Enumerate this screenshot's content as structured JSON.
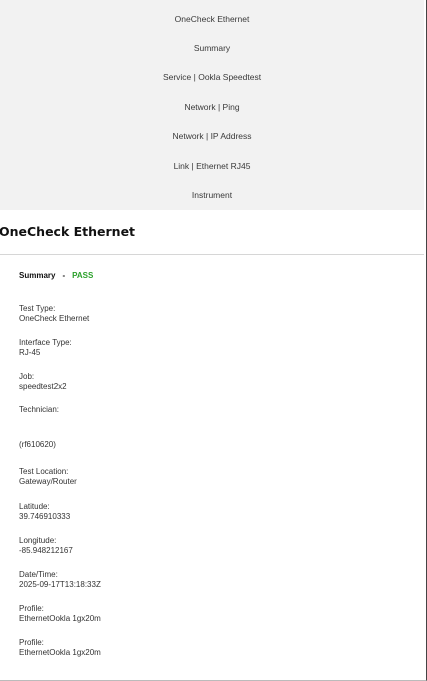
{
  "nav": {
    "items": [
      "OneCheck Ethernet",
      "Summary",
      "Service | Ookla Speedtest",
      "Network | Ping",
      "Network | IP Address",
      "Link | Ethernet RJ45",
      "Instrument"
    ]
  },
  "page": {
    "title": "OneCheck Ethernet"
  },
  "summary": {
    "label": "Summary",
    "separator": "-",
    "status": "PASS",
    "status_color": "#2aa02a"
  },
  "fields": [
    {
      "label": "Test Type:",
      "value": "OneCheck Ethernet"
    },
    {
      "label": "Interface Type:",
      "value": "RJ-45"
    },
    {
      "label": "Job:",
      "value": "speedtest2x2"
    },
    {
      "label": "Technician:",
      "value": ""
    },
    {
      "label": "",
      "value": "(rf610620)"
    },
    {
      "label": "Test Location:",
      "value": "Gateway/Router"
    },
    {
      "label": "Latitude:",
      "value": "39.746910333"
    },
    {
      "label": "Longitude:",
      "value": "-85.948212167"
    },
    {
      "label": "Date/Time:",
      "value": "2025-09-17T13:18:33Z"
    },
    {
      "label": "Profile:",
      "value": "EthernetOokla 1gx20m"
    },
    {
      "label": "Profile:",
      "value": "EthernetOokla 1gx20m"
    }
  ]
}
